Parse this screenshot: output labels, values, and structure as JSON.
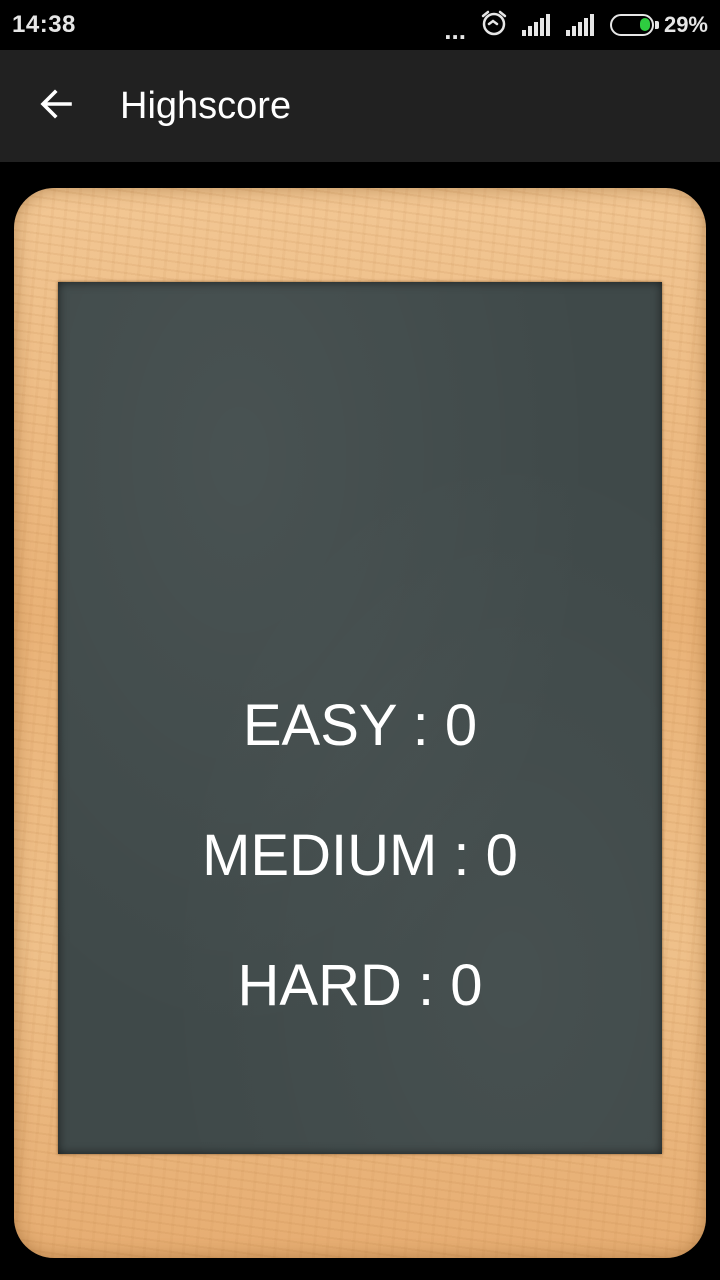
{
  "status_bar": {
    "time": "14:38",
    "dots": "...",
    "battery_percent": "29%",
    "battery_level": 0.29,
    "icons": [
      "alarm-icon",
      "signal-icon",
      "signal-icon",
      "battery-icon"
    ]
  },
  "app_bar": {
    "title": "Highscore",
    "back_icon": "arrow-left-icon"
  },
  "scores": [
    {
      "label": "EASY",
      "separator": " : ",
      "value": "0",
      "text": "EASY : 0"
    },
    {
      "label": "MEDIUM",
      "separator": " : ",
      "value": "0",
      "text": "MEDIUM : 0"
    },
    {
      "label": "HARD",
      "separator": " : ",
      "value": "0",
      "text": "HARD : 0"
    }
  ],
  "colors": {
    "app_bar": "#212121",
    "chalkboard": "#3f4949",
    "frame_wood": "#e9b277",
    "battery_fill": "#2ecc40",
    "text": "#ffffff"
  }
}
